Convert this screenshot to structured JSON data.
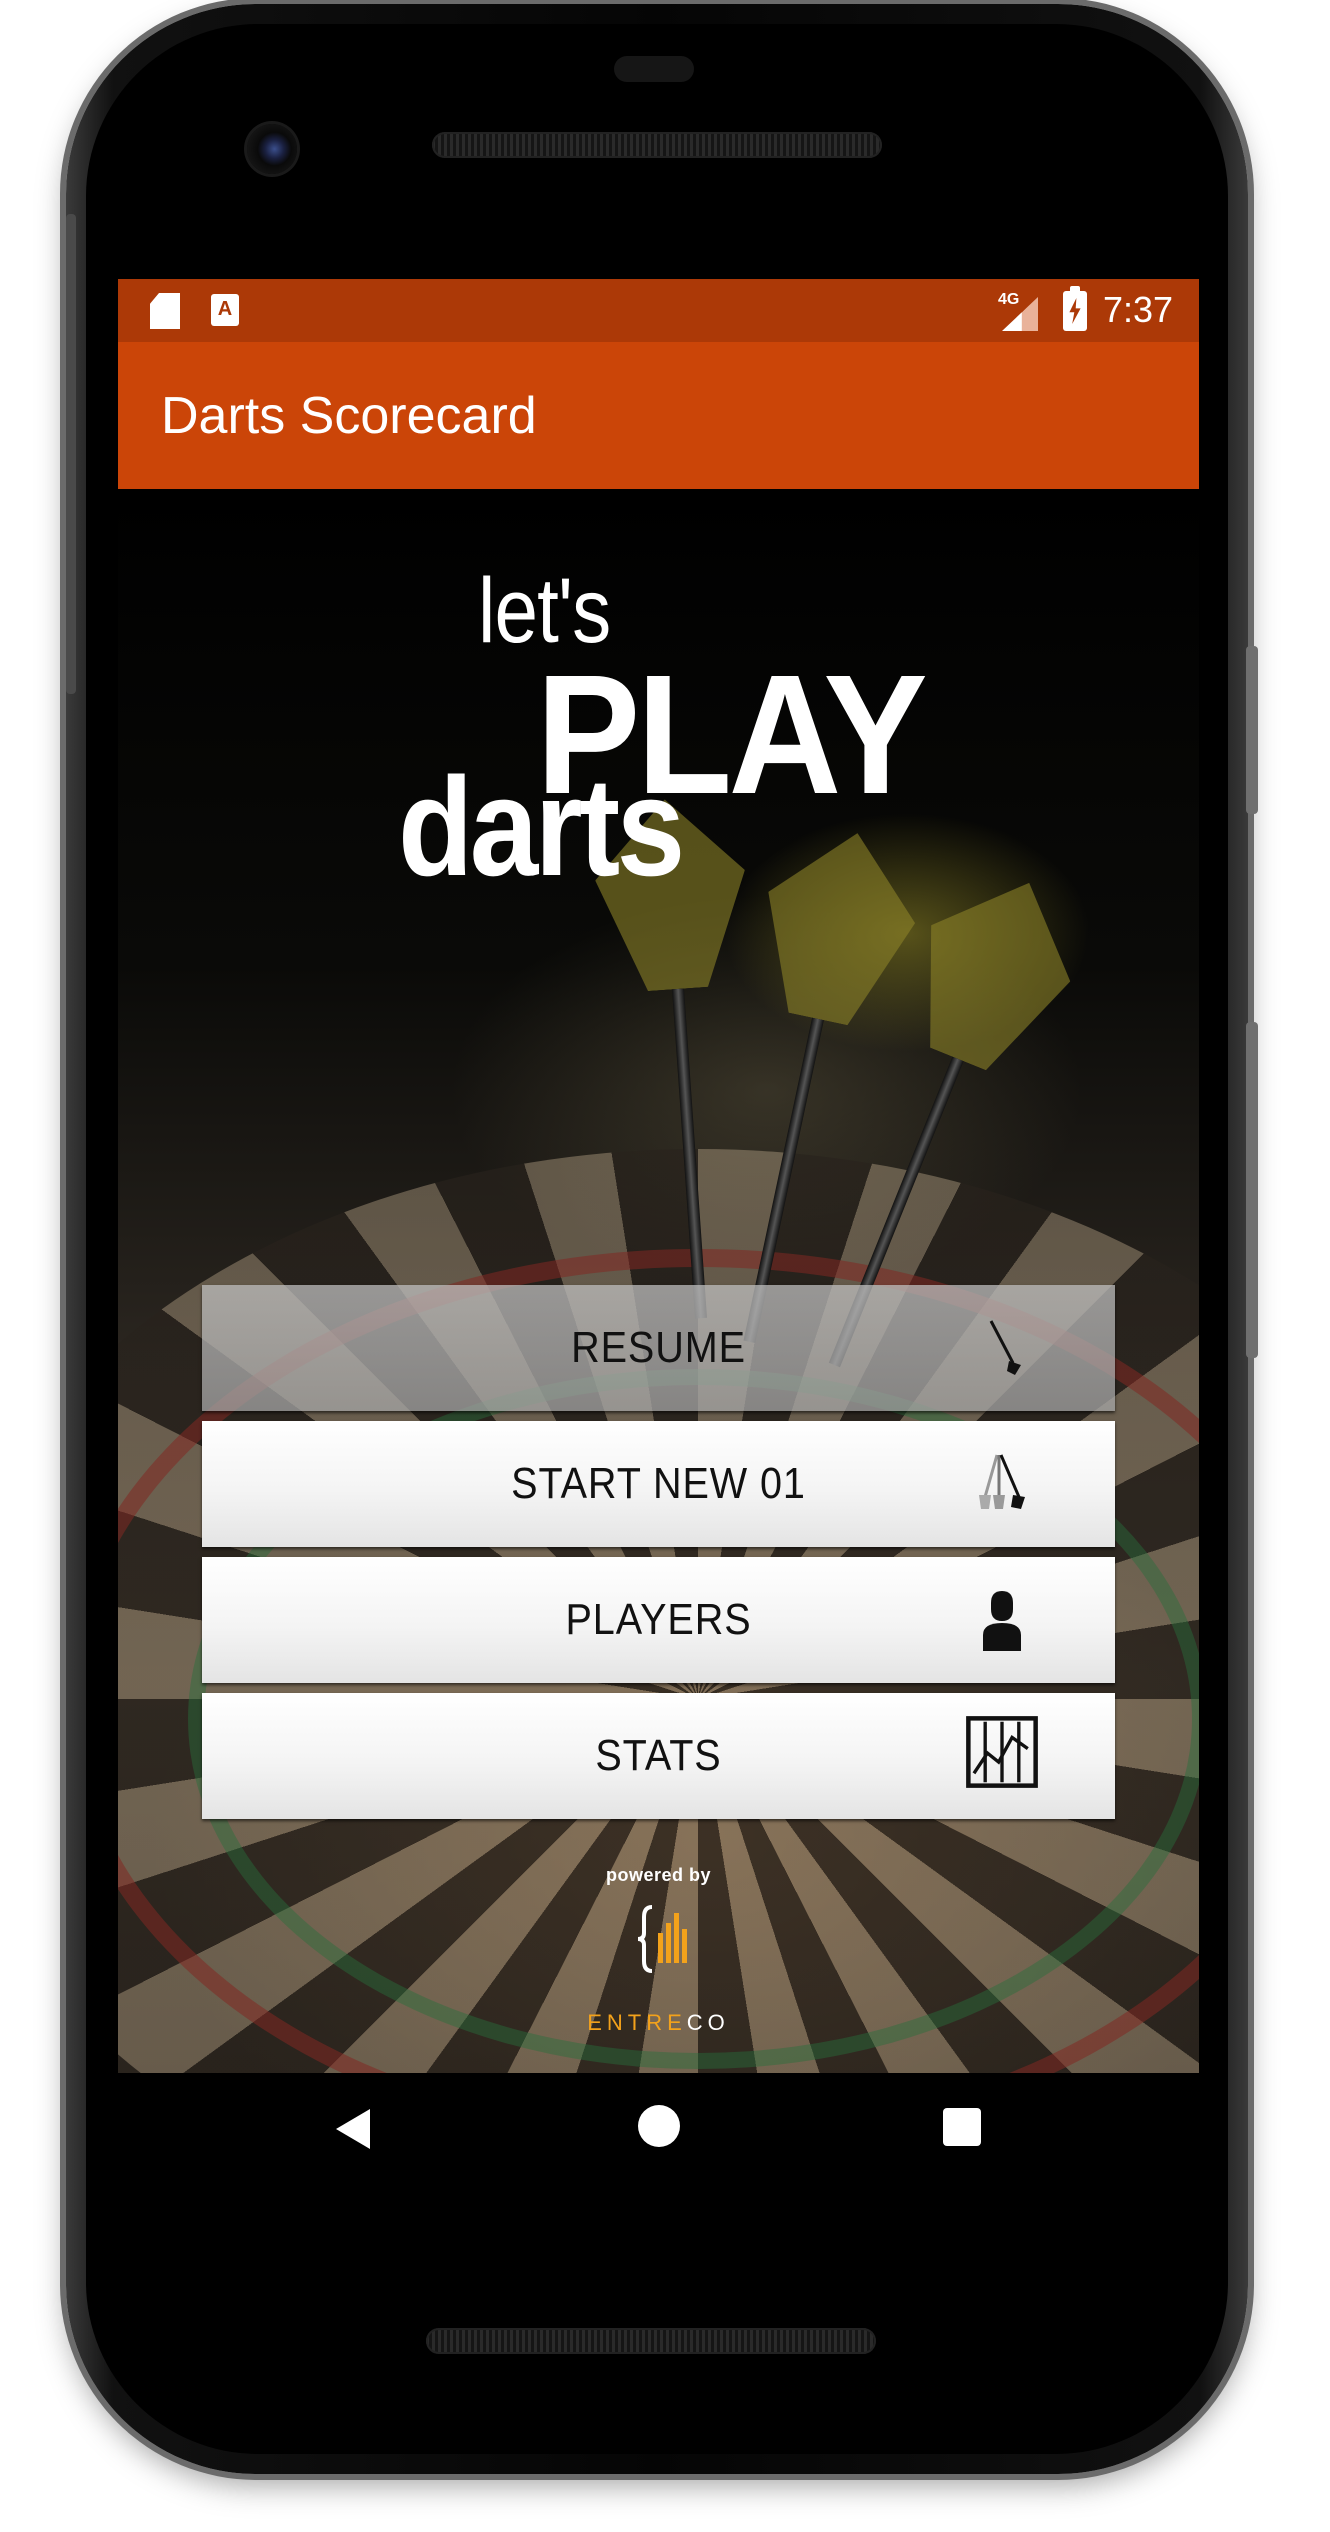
{
  "status_bar": {
    "network": "4G",
    "time": "7:37",
    "notification_letter": "A"
  },
  "app_bar": {
    "title": "Darts Scorecard"
  },
  "logo": {
    "line1": "let's",
    "line2": "PLAY",
    "line3": "darts"
  },
  "menu": {
    "items": [
      {
        "label": "RESUME",
        "icon": "single-dart-icon",
        "enabled": false
      },
      {
        "label": "START NEW 01",
        "icon": "three-darts-icon",
        "enabled": true
      },
      {
        "label": "PLAYERS",
        "icon": "person-icon",
        "enabled": true
      },
      {
        "label": "STATS",
        "icon": "stats-chart-icon",
        "enabled": true
      }
    ]
  },
  "footer": {
    "powered_by": "powered by",
    "brand_part1": "ENTRE",
    "brand_part2": "CO"
  },
  "colors": {
    "status_bar": "#ac3907",
    "app_bar": "#cb4508",
    "brand_accent": "#f3a21b"
  }
}
